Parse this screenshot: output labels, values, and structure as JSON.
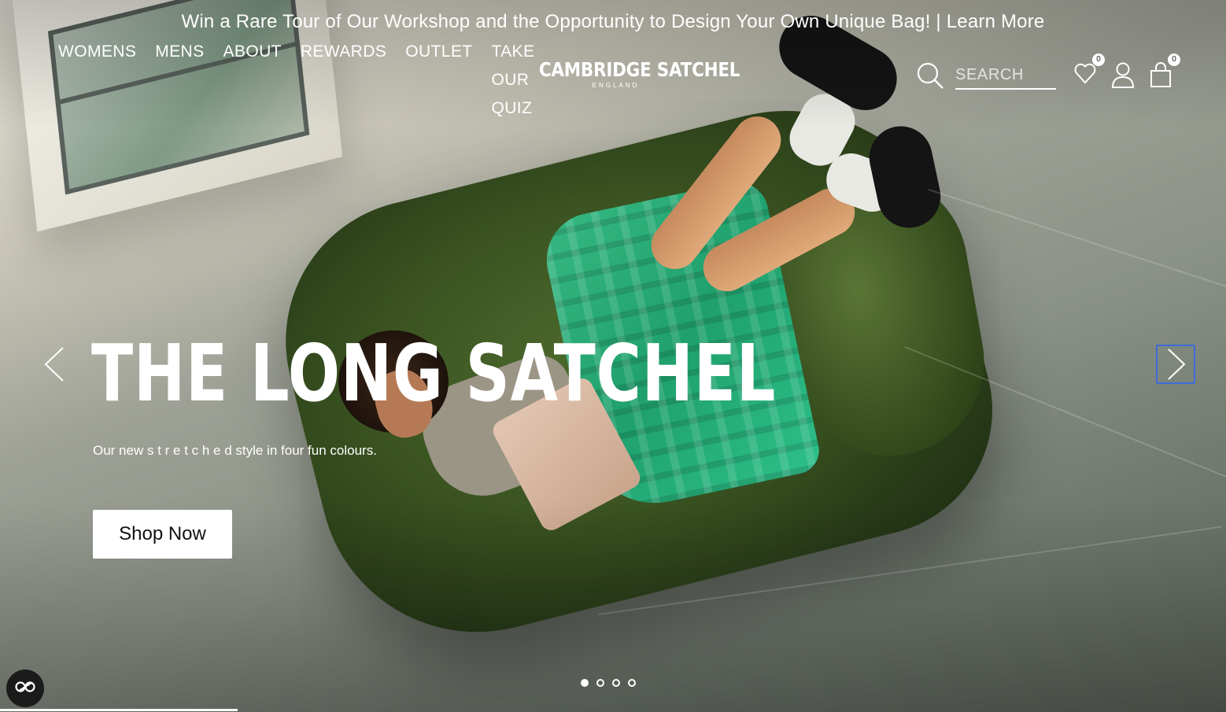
{
  "announcement": {
    "text": "Win a Rare Tour of Our Workshop and the Opportunity to Design Your Own Unique Bag! | ",
    "link": "Learn More"
  },
  "nav": {
    "items": [
      "WOMENS",
      "MENS",
      "ABOUT",
      "REWARDS",
      "OUTLET"
    ],
    "quiz": [
      "TAKE",
      "OUR",
      "QUIZ"
    ]
  },
  "logo": {
    "main": "CAMBRIDGE SATCHEL",
    "sub": "ENGLAND"
  },
  "search": {
    "placeholder": "SEARCH",
    "icon": "search-icon"
  },
  "icons": {
    "wishlist": {
      "name": "heart-icon",
      "count": "0"
    },
    "account": {
      "name": "user-icon"
    },
    "cart": {
      "name": "shopping-bag-icon",
      "count": "0"
    }
  },
  "hero": {
    "title": "THE LONG SATCHEL",
    "subtitle": "Our new s t r e t c h e d style in four fun colours.",
    "cta": "Shop Now"
  },
  "carousel": {
    "slide_count": 4,
    "active_index": 0,
    "prev_icon": "chevron-left-icon",
    "next_icon": "chevron-right-icon"
  },
  "colors": {
    "text_on_hero": "#ffffff",
    "focus_outline": "#3d6bd8",
    "a11y_button": "#1b1b1b"
  }
}
